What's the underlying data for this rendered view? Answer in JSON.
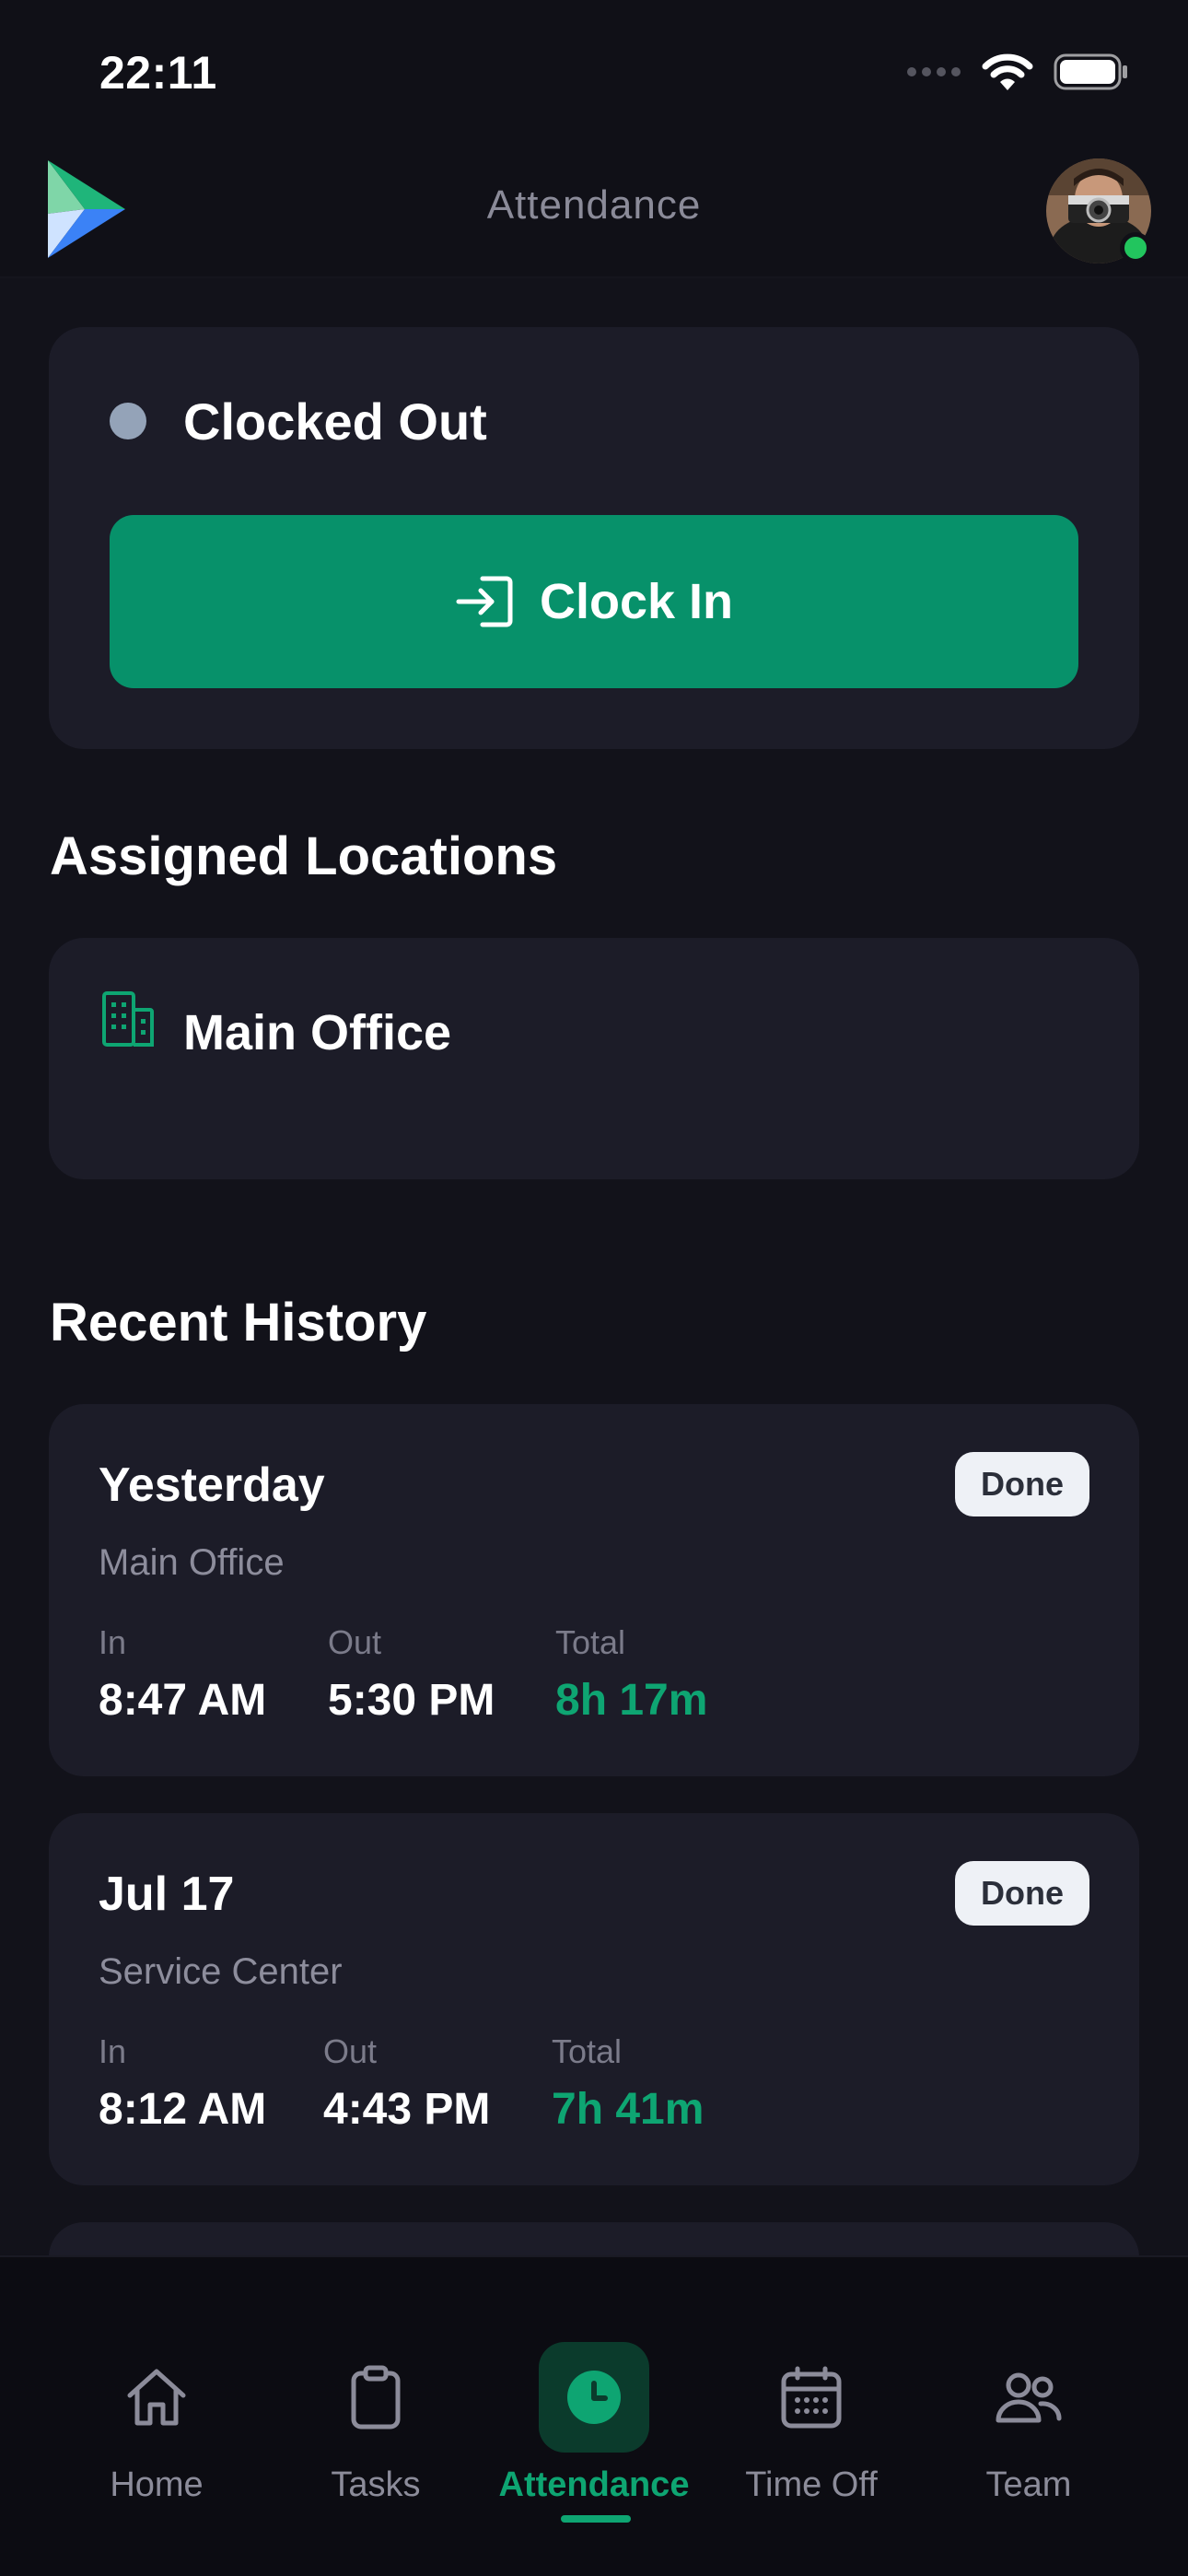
{
  "status_bar": {
    "time": "22:11"
  },
  "header": {
    "title": "Attendance"
  },
  "clock_card": {
    "status": "Clocked Out",
    "button_label": "Clock In"
  },
  "assigned_locations": {
    "title": "Assigned Locations",
    "items": [
      {
        "name": "Main Office"
      }
    ]
  },
  "recent_history": {
    "title": "Recent History",
    "in_label": "In",
    "out_label": "Out",
    "total_label": "Total",
    "items": [
      {
        "date": "Yesterday",
        "location": "Main Office",
        "badge": "Done",
        "in": "8:47 AM",
        "out": "5:30 PM",
        "total": "8h 17m"
      },
      {
        "date": "Jul 17",
        "location": "Service Center",
        "badge": "Done",
        "in": "8:12 AM",
        "out": "4:43 PM",
        "total": "7h 41m"
      }
    ]
  },
  "tabs": [
    {
      "label": "Home",
      "icon": "home-icon",
      "active": false
    },
    {
      "label": "Tasks",
      "icon": "clipboard-icon",
      "active": false
    },
    {
      "label": "Attendance",
      "icon": "clock-icon",
      "active": true
    },
    {
      "label": "Time Off",
      "icon": "calendar-icon",
      "active": false
    },
    {
      "label": "Team",
      "icon": "team-icon",
      "active": false
    }
  ],
  "colors": {
    "accent": "#07916a",
    "accent_text": "#0ea572",
    "background": "#12121a",
    "card": "#1c1c28"
  }
}
